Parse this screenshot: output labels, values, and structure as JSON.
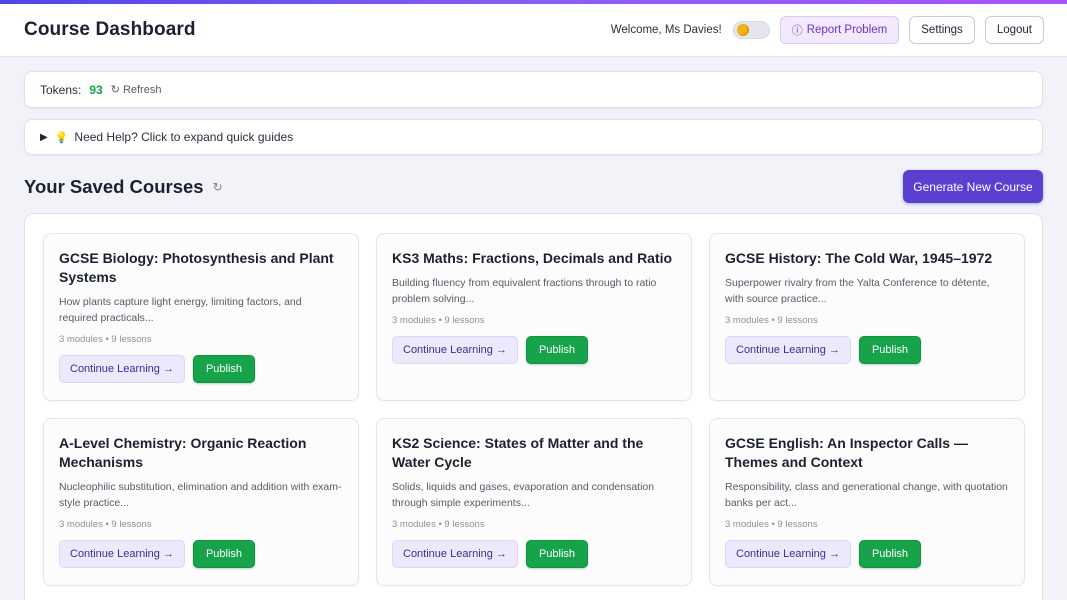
{
  "header": {
    "title": "Course Dashboard",
    "welcome": "Welcome, Ms Davies!",
    "report_label": "Report Problem",
    "settings_label": "Settings",
    "logout_label": "Logout"
  },
  "tokens": {
    "label": "Tokens:",
    "value": "93",
    "refresh_label": "Refresh"
  },
  "help": {
    "text": "Need Help? Click to expand quick guides"
  },
  "section": {
    "title": "Your Saved Courses",
    "generate_label": "Generate New Course"
  },
  "card_actions": {
    "continue_label": "Continue Learning →",
    "publish_label": "Publish"
  },
  "courses": [
    {
      "title": "GCSE Biology: Photosynthesis and Plant Systems",
      "description": "How plants capture light energy, limiting factors, and required practicals...",
      "meta": "3 modules • 9 lessons"
    },
    {
      "title": "KS3 Maths: Fractions, Decimals and Ratio",
      "description": "Building fluency from equivalent fractions through to ratio problem solving...",
      "meta": "3 modules • 9 lessons"
    },
    {
      "title": "GCSE History: The Cold War, 1945–1972",
      "description": "Superpower rivalry from the Yalta Conference to détente, with source practice...",
      "meta": "3 modules • 9 lessons"
    },
    {
      "title": "A-Level Chemistry: Organic Reaction Mechanisms",
      "description": "Nucleophilic substitution, elimination and addition with exam-style practice...",
      "meta": "3 modules • 9 lessons"
    },
    {
      "title": "KS2 Science: States of Matter and the Water Cycle",
      "description": "Solids, liquids and gases, evaporation and condensation through simple experiments...",
      "meta": "3 modules • 9 lessons"
    },
    {
      "title": "GCSE English: An Inspector Calls — Themes and Context",
      "description": "Responsibility, class and generational change, with quotation banks per act...",
      "meta": "3 modules • 9 lessons"
    }
  ],
  "icons": {
    "info": "info-icon",
    "refresh": "refresh-icon",
    "expand": "triangle-right-icon",
    "bulb": "lightbulb-icon"
  },
  "colors": {
    "accent": "#5b3fd0",
    "publish": "#16a34a",
    "tokens": "#16a34a",
    "report": "#6d33c9"
  }
}
